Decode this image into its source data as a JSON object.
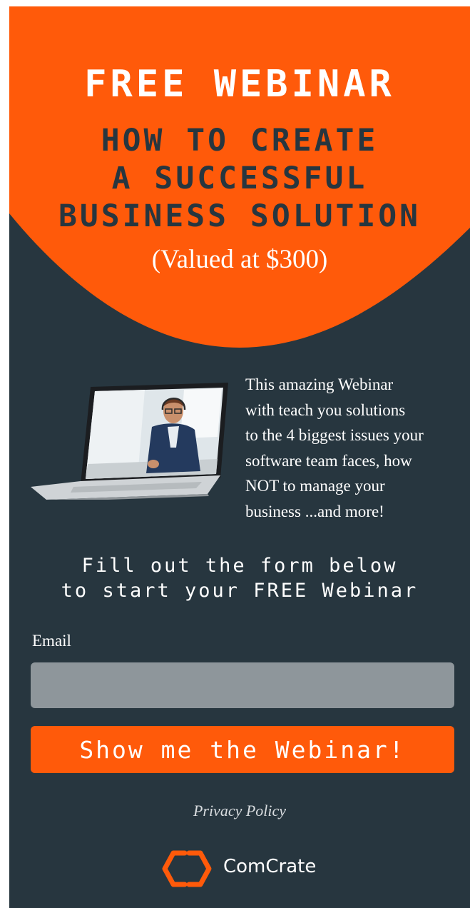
{
  "colors": {
    "accent": "#ff5a0a",
    "panel": "#27363f",
    "input": "#8e969b"
  },
  "hero": {
    "title": "FREE WEBINAR",
    "subtitle_lines": [
      "HOW TO CREATE",
      "A SUCCESSFUL",
      "BUSINESS SOLUTION"
    ],
    "value_text": "(Valued at $300)"
  },
  "promo": {
    "image_icon": "laptop-video-call-illustration",
    "lines": [
      "This amazing Webinar",
      "with teach you solutions",
      "to the 4 biggest issues your",
      "software team faces, how",
      "NOT to manage your",
      "business ...and more!"
    ]
  },
  "cta": {
    "lines": [
      "Fill out the form below",
      "to start your FREE Webinar"
    ]
  },
  "form": {
    "email_label": "Email",
    "email_value": "",
    "email_placeholder": "",
    "submit_label": "Show me the Webinar!"
  },
  "footer": {
    "privacy_label": "Privacy Policy",
    "brand_name": "ComCrate",
    "brand_icon": "comcrate-logo-icon"
  }
}
